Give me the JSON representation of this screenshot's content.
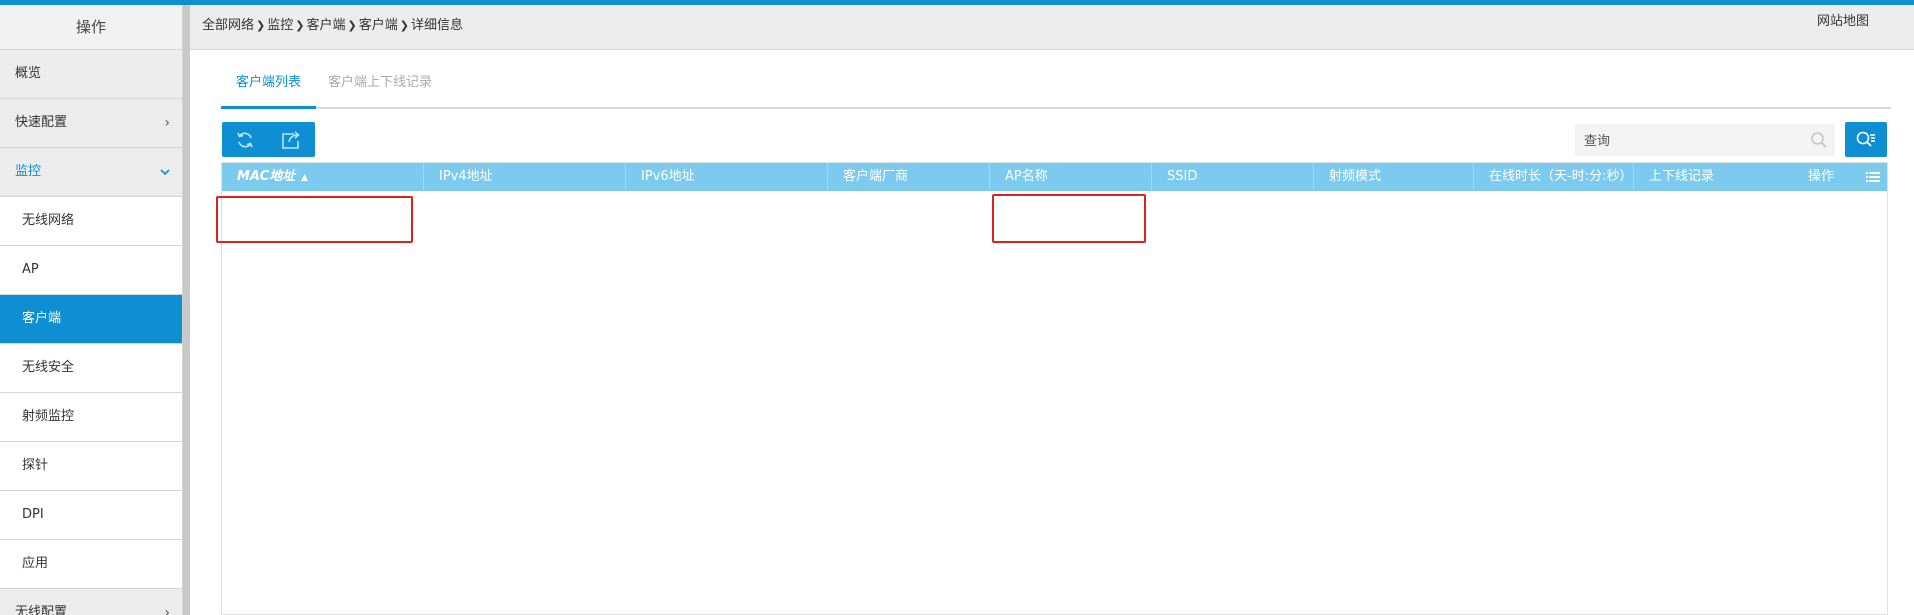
{
  "sidebar": {
    "header": "操作",
    "items": [
      {
        "label": "概览"
      },
      {
        "label": "快速配置"
      },
      {
        "label": "监控"
      },
      {
        "label": "无线网络"
      },
      {
        "label": "AP"
      },
      {
        "label": "客户端"
      },
      {
        "label": "无线安全"
      },
      {
        "label": "射频监控"
      },
      {
        "label": "探针"
      },
      {
        "label": "DPI"
      },
      {
        "label": "应用"
      },
      {
        "label": "无线配置"
      }
    ]
  },
  "breadcrumb": [
    "全部网络",
    "监控",
    "客户端",
    "客户端",
    "详细信息"
  ],
  "header": {
    "sitemap": "网站地图"
  },
  "tabs": [
    {
      "label": "客户端列表",
      "active": true
    },
    {
      "label": "客户端上下线记录",
      "active": false
    }
  ],
  "toolbar": {
    "refresh_icon": "refresh-icon",
    "export_icon": "export-icon"
  },
  "search": {
    "placeholder": "查询"
  },
  "table": {
    "columns": [
      {
        "label": "MAC地址",
        "sorted": "asc"
      },
      {
        "label": "IPv4地址"
      },
      {
        "label": "IPv6地址"
      },
      {
        "label": "客户端厂商"
      },
      {
        "label": "AP名称"
      },
      {
        "label": "SSID"
      },
      {
        "label": "射频模式"
      },
      {
        "label": "在线时长（天-时:分:秒）"
      },
      {
        "label": "上下线记录"
      },
      {
        "label": "操作"
      }
    ],
    "rows": []
  },
  "colors": {
    "accent": "#0e8fd4",
    "table_header": "#7ccbee",
    "highlight": "#e0201a"
  }
}
